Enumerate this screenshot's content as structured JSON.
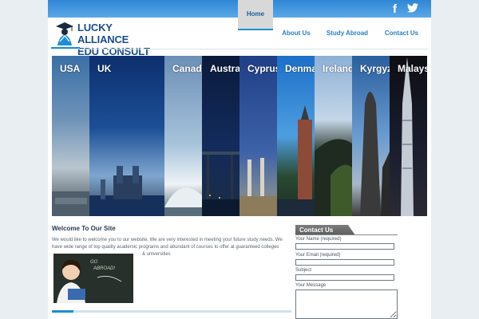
{
  "social": {
    "facebook": "f",
    "twitter": "t"
  },
  "logo": {
    "line1": "LUCKY ALLIANCE",
    "line2": "EDU CONSULT"
  },
  "nav": {
    "items": [
      {
        "label": "Home",
        "active": true
      },
      {
        "label": "About Us",
        "active": false
      },
      {
        "label": "Study Abroad",
        "active": false
      },
      {
        "label": "Contact Us",
        "active": false
      }
    ]
  },
  "slider": {
    "panels": [
      {
        "label": "USA"
      },
      {
        "label": "UK"
      },
      {
        "label": "Canada"
      },
      {
        "label": "Australia"
      },
      {
        "label": "Cyprus"
      },
      {
        "label": "Denmark"
      },
      {
        "label": "Ireland"
      },
      {
        "label": "Kyrgyzstan"
      },
      {
        "label": "Malaysia"
      }
    ]
  },
  "welcome": {
    "title": "Welcome To Our Site",
    "text": "We would like to welcome you to our website. We are very interested in meeting your future study needs. We have wide range of top quality academic programs and abundant of courses to offer at guaranteed colleges",
    "text_tail": "& universities",
    "progress": 0.09
  },
  "contact": {
    "title": "Contact Us",
    "name_label": "Your Name (required)",
    "email_label": "Your Email (required)",
    "subject_label": "Subject",
    "message_label": "Your Message"
  },
  "colors": {
    "accent": "#1d8fd6",
    "nav_text": "#2c7fc4",
    "logo_text": "#1b4e8d"
  }
}
